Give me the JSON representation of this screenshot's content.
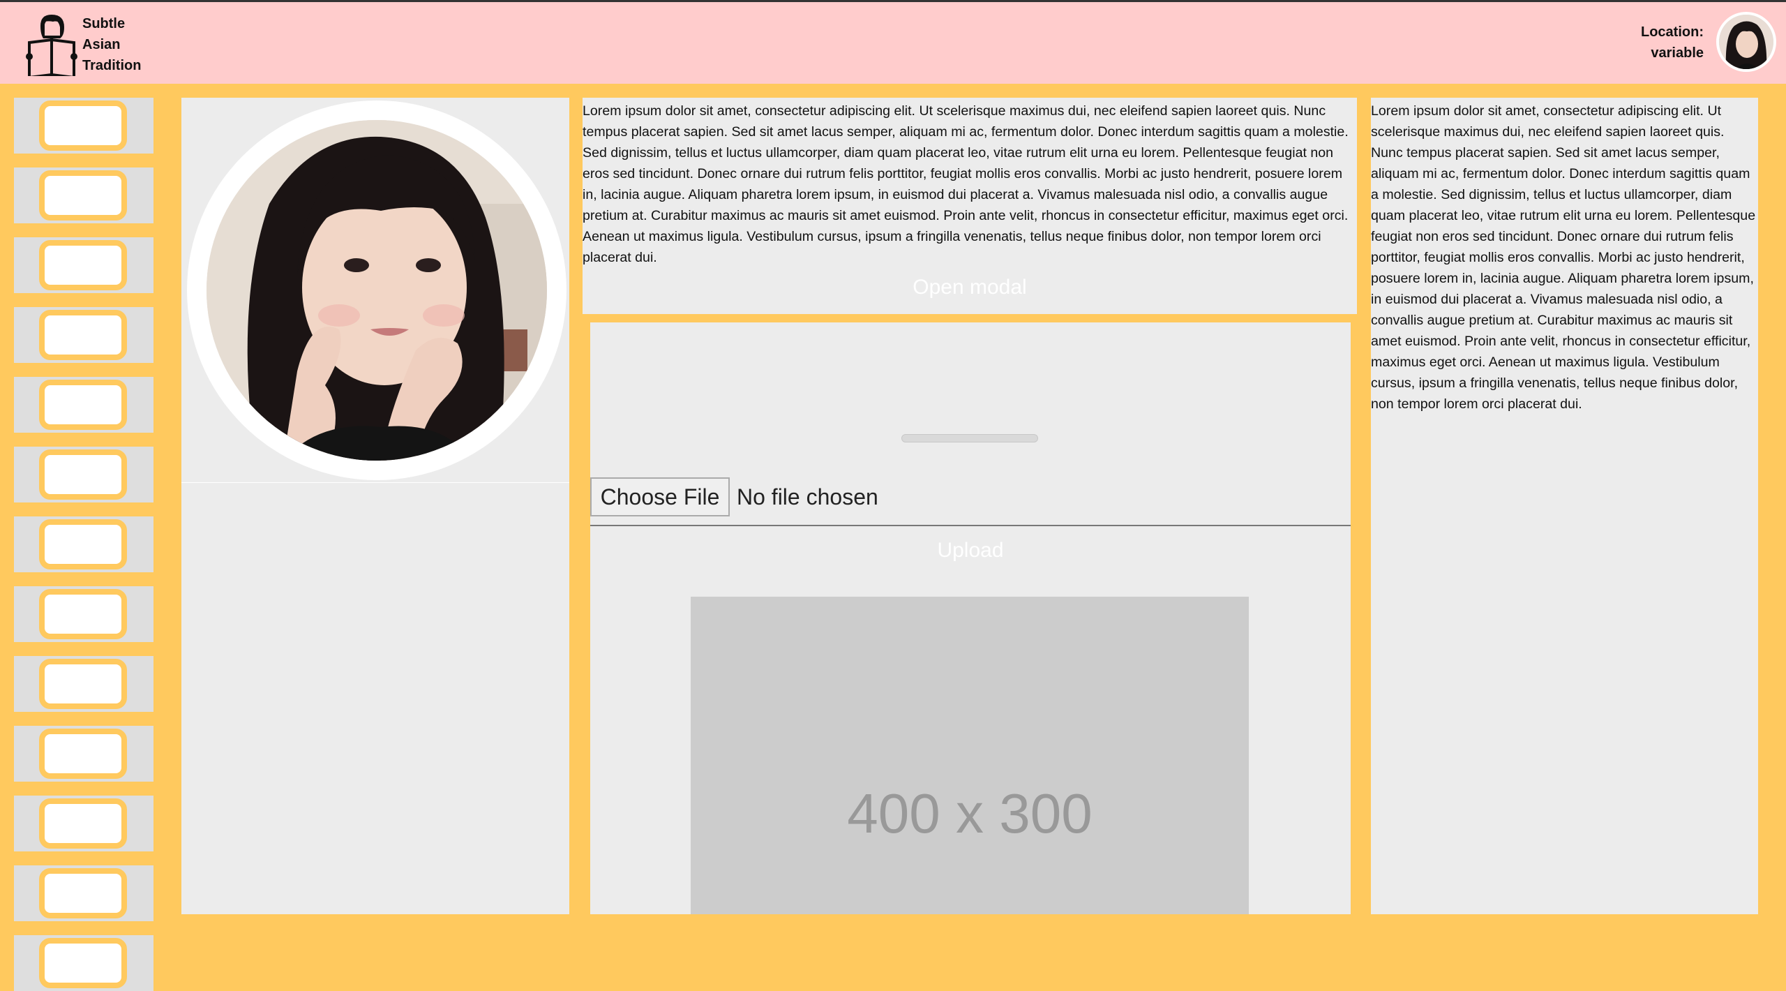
{
  "header": {
    "brand_line1": "Subtle",
    "brand_line2": "Asian",
    "brand_line3": "Tradition",
    "location_label": "Location:",
    "location_value": "variable"
  },
  "sidebar": {
    "items": [
      "",
      "",
      "",
      "",
      "",
      "",
      "",
      "",
      "",
      "",
      "",
      "",
      ""
    ]
  },
  "text_panel": {
    "body": "Lorem ipsum dolor sit amet, consectetur adipiscing elit. Ut scelerisque maximus dui, nec eleifend sapien laoreet quis. Nunc tempus placerat sapien. Sed sit amet lacus semper, aliquam mi ac, fermentum dolor. Donec interdum sagittis quam a molestie. Sed dignissim, tellus et luctus ullamcorper, diam quam placerat leo, vitae rutrum elit urna eu lorem. Pellentesque feugiat non eros sed tincidunt. Donec ornare dui rutrum felis porttitor, feugiat mollis eros convallis. Morbi ac justo hendrerit, posuere lorem in, lacinia augue. Aliquam pharetra lorem ipsum, in euismod dui placerat a. Vivamus malesuada nisl odio, a convallis augue pretium at. Curabitur maximus ac mauris sit amet euismod. Proin ante velit, rhoncus in consectetur efficitur, maximus eget orci. Aenean ut maximus ligula. Vestibulum cursus, ipsum a fringilla venenatis, tellus neque finibus dolor, non tempor lorem orci placerat dui.",
    "open_modal_label": "Open modal"
  },
  "upload": {
    "choose_file_label": "Choose File",
    "file_status": "No file chosen",
    "upload_label": "Upload",
    "placeholder_label": "400 x 300"
  },
  "right_panel": {
    "body": "Lorem ipsum dolor sit amet, consectetur adipiscing elit. Ut scelerisque maximus dui, nec eleifend sapien laoreet quis. Nunc tempus placerat sapien. Sed sit amet lacus semper, aliquam mi ac, fermentum dolor. Donec interdum sagittis quam a molestie. Sed dignissim, tellus et luctus ullamcorper, diam quam placerat leo, vitae rutrum elit urna eu lorem. Pellentesque feugiat non eros sed tincidunt. Donec ornare dui rutrum felis porttitor, feugiat mollis eros convallis. Morbi ac justo hendrerit, posuere lorem in, lacinia augue. Aliquam pharetra lorem ipsum, in euismod dui placerat a. Vivamus malesuada nisl odio, a convallis augue pretium at. Curabitur maximus ac mauris sit amet euismod. Proin ante velit, rhoncus in consectetur efficitur, maximus eget orci. Aenean ut maximus ligula. Vestibulum cursus, ipsum a fringilla venenatis, tellus neque finibus dolor, non tempor lorem orci placerat dui."
  },
  "colors": {
    "header_bg": "#ffcccc",
    "page_bg": "#ffc95e",
    "panel_bg": "#ececec"
  },
  "icons": {
    "logo": "reading-person-logo-icon",
    "avatar": "user-avatar"
  }
}
